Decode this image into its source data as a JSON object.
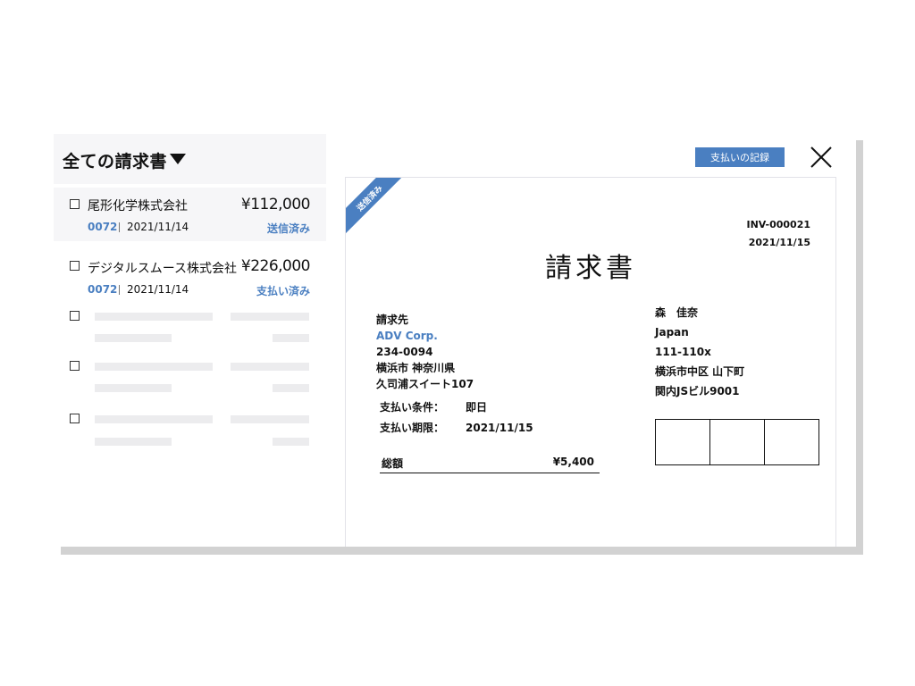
{
  "list": {
    "title": "全ての請求書",
    "invoices": [
      {
        "company": "尾形化学株式会社",
        "amount": "¥112,000",
        "id": "0072",
        "date": "2021/11/14",
        "status": "送信済み"
      },
      {
        "company": "デジタルスムース株式会社",
        "amount": "¥226,000",
        "id": "0072",
        "date": "2021/11/14",
        "status": "支払い済み"
      }
    ]
  },
  "toolbar": {
    "record_payment_label": "支払いの記録"
  },
  "invoice": {
    "ribbon": "送信済み",
    "number": "INV-000021",
    "date": "2021/11/15",
    "heading": "請求書",
    "bill_to": {
      "label": "請求先",
      "company": "ADV Corp.",
      "postal": "234-0094",
      "city": "横浜市 神奈川県",
      "address": "久司浦スイート107"
    },
    "terms": {
      "payment_terms_label": "支払い条件：",
      "payment_terms_value": "即日",
      "due_label": "支払い期限：",
      "due_value": "2021/11/15"
    },
    "total": {
      "label": "総額",
      "value": "¥5,400"
    },
    "sender": {
      "name": "森　佳奈",
      "country": "Japan",
      "postal": "111-110x",
      "city": "横浜市中区 山下町",
      "building": "関内JSビル9001"
    }
  },
  "colors": {
    "accent": "#4a7fc1",
    "shadow": "#d2d2d2",
    "selected_bg": "#f6f6f8"
  },
  "icons": {
    "close": "close-icon",
    "dropdown": "chevron-down-icon"
  }
}
